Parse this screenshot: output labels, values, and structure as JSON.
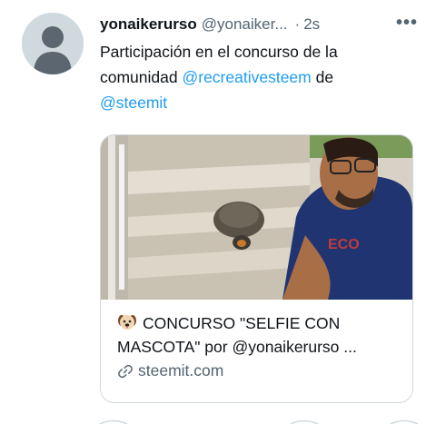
{
  "tweet": {
    "author_name": "yonaikerurso",
    "author_handle": "@yonaiker...",
    "separator": "·",
    "time": "2s",
    "more_icon": "more-horizontal-icon",
    "text_part1": "Participación en el concurso de la comunidad ",
    "mention1": "@recreativesteem",
    "text_part2": " de",
    "mention2": "@steemit"
  },
  "card": {
    "title_emoji_icon": "dog-face-icon",
    "title": "CONCURSO \"SELFIE CON MASCOTA\" por @yonaikerurso ...",
    "domain_icon": "link-icon",
    "domain": "steemit.com"
  },
  "colors": {
    "accent": "#1d9bf0",
    "text": "#0f1419",
    "muted": "#536471",
    "avatar_bg": "#cfd9de",
    "border": "#cfd9de"
  }
}
